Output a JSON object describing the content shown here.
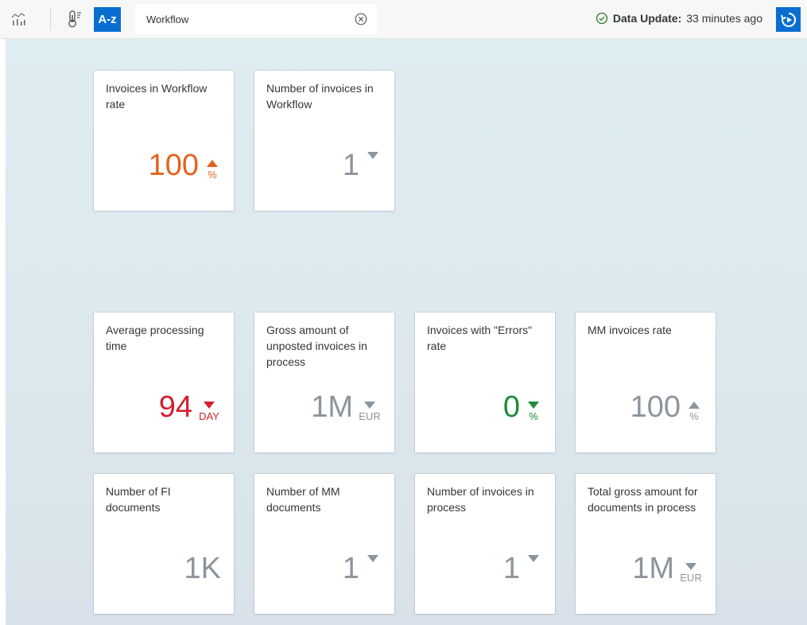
{
  "toolbar": {
    "search_value": "Workflow",
    "az_label": "A-z",
    "update_label": "Data Update:",
    "update_time": "33 minutes ago"
  },
  "colors": {
    "accent": "#0a6ed1",
    "orange": "#e5621d",
    "red": "#d32030",
    "green": "#1d8a3a",
    "neutral": "#8b959e"
  },
  "tiles": [
    {
      "title": "Invoices in Workflow rate",
      "value": "100",
      "unit": "%",
      "trend": "up",
      "color": "orange"
    },
    {
      "title": "Number of invoices in Workflow",
      "value": "1",
      "unit": "",
      "trend": "down",
      "color": "grey"
    },
    {
      "title": "Average processing time",
      "value": "94",
      "unit": "DAY",
      "trend": "down",
      "color": "red"
    },
    {
      "title": "Gross amount of unposted invoices in process",
      "value": "1M",
      "unit": "EUR",
      "trend": "down",
      "color": "grey"
    },
    {
      "title": "Invoices with \"Errors\" rate",
      "value": "0",
      "unit": "%",
      "trend": "down",
      "color": "green"
    },
    {
      "title": "MM invoices rate",
      "value": "100",
      "unit": "%",
      "trend": "up",
      "color": "grey"
    },
    {
      "title": "Number of FI documents",
      "value": "1K",
      "unit": "",
      "trend": "none",
      "color": "grey"
    },
    {
      "title": "Number of MM documents",
      "value": "1",
      "unit": "",
      "trend": "down",
      "color": "grey"
    },
    {
      "title": "Number of invoices in process",
      "value": "1",
      "unit": "",
      "trend": "down",
      "color": "grey"
    },
    {
      "title": "Total gross amount for documents in process",
      "value": "1M",
      "unit": "EUR",
      "trend": "down",
      "color": "grey"
    }
  ]
}
